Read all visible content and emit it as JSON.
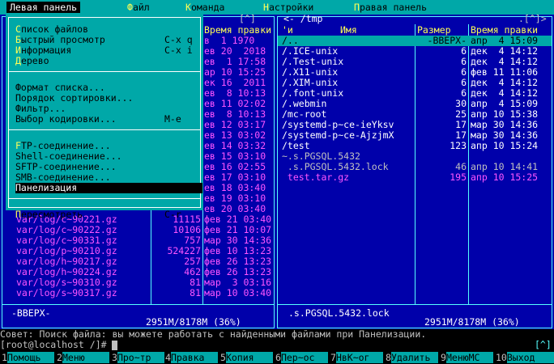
{
  "menubar": {
    "items": [
      {
        "hk": "",
        "rest": "Левая панель",
        "active": true
      },
      {
        "hk": "Ф",
        "rest": "айл"
      },
      {
        "hk": "К",
        "rest": "оманда"
      },
      {
        "hk": "Н",
        "rest": "астройки"
      },
      {
        "hk": "П",
        "rest": "равая панель"
      }
    ]
  },
  "left_panel": {
    "headers": {
      "time": "Время правки"
    },
    "top_right_marker": "[^]",
    "visible_top_rows": [
      {
        "date": "в  1 1970"
      },
      {
        "date": "ев 20  2018"
      },
      {
        "date": "ев  1 17:58"
      },
      {
        "date": "ар 10 15:25"
      },
      {
        "date": "ек 16  2011"
      },
      {
        "date": "ев  8 10:13"
      },
      {
        "date": "ев 11 02:02"
      },
      {
        "date": "ев  8 10:13"
      },
      {
        "date": "ев 12 03:17"
      },
      {
        "date": "ев 13 03:02"
      },
      {
        "date": "ев 14 03:32"
      },
      {
        "date": "ев 15 03:10"
      },
      {
        "date": "ев 16 02:55"
      },
      {
        "date": "ев 17 03:10"
      },
      {
        "date": "ев 18 03:40"
      },
      {
        "date": "ев 19 03:10"
      },
      {
        "date": "ев 20 03:40"
      }
    ],
    "files": [
      {
        "name": "var/log/c~90221.gz",
        "size": "11115",
        "date": "фев 21 03:40"
      },
      {
        "name": "var/log/c~90222.gz",
        "size": "10106",
        "date": "фев 21 10:07"
      },
      {
        "name": "var/log/c~90331.gz",
        "size": "757",
        "date": "мар 30 14:36"
      },
      {
        "name": "var/log/p~90210.gz",
        "size": "524227",
        "date": "фев 10 13:23"
      },
      {
        "name": "var/log/h~90217.gz",
        "size": "257",
        "date": "фев 26 13:23"
      },
      {
        "name": "var/log/h~90224.gz",
        "size": "462",
        "date": "фев 26 13:23"
      },
      {
        "name": "var/log/s~90310.gz",
        "size": "81",
        "date": "мар  3 03:16"
      },
      {
        "name": "var/log/s~90317.gz",
        "size": "81",
        "date": "мар 10 03:40"
      }
    ],
    "status": "-ВВЕРХ-",
    "free": "2951M/8178M (36%)"
  },
  "right_panel": {
    "path": "<- /tmp",
    "top_right_marker": ".[^]>",
    "headers": {
      "sort": "'и",
      "name": "Имя",
      "size": "Размер",
      "time": "Время правки"
    },
    "files": [
      {
        "name": "/..",
        "size": "-ВВЕРХ-",
        "date": "апр  4 15:09",
        "color": "white"
      },
      {
        "name": "/.ICE-unix",
        "size": "6",
        "date": "дек  4 14:12",
        "color": "white"
      },
      {
        "name": "/.Test-unix",
        "size": "6",
        "date": "дек  4 14:12",
        "color": "white"
      },
      {
        "name": "/.X11-unix",
        "size": "6",
        "date": "фев 11 11:06",
        "color": "white"
      },
      {
        "name": "/.XIM-unix",
        "size": "6",
        "date": "дек  4 14:12",
        "color": "white"
      },
      {
        "name": "/.font-unix",
        "size": "6",
        "date": "дек  4 14:12",
        "color": "white"
      },
      {
        "name": "/.webmin",
        "size": "30",
        "date": "апр  4 15:09",
        "color": "white"
      },
      {
        "name": "/mc-root",
        "size": "25",
        "date": "апр 10 15:38",
        "color": "white"
      },
      {
        "name": "/systemd-p~ce-ieYksv",
        "size": "17",
        "date": "мар 30 14:36",
        "color": "white"
      },
      {
        "name": "/systemd-p~ce-AjzjmX",
        "size": "17",
        "date": "мар 30 14:36",
        "color": "white"
      },
      {
        "name": "/test",
        "size": "123",
        "date": "апр 10 15:24",
        "color": "white"
      },
      {
        "name": "~.s.PGSQL.5432",
        "size": "",
        "date": "",
        "color": "gray"
      },
      {
        "name": " .s.PGSQL.5432.lock",
        "size": "46",
        "date": "апр 10 14:41",
        "color": "gray"
      },
      {
        "name": " test.tar.gz",
        "size": "195",
        "date": "апр 10 15:25",
        "color": "magenta"
      }
    ],
    "status": ".s.PGSQL.5432.lock",
    "free": "2951M/8178M (36%)"
  },
  "dropdown": {
    "groups": [
      [
        {
          "hk": "С",
          "rest": "писок файлов",
          "sc": ""
        },
        {
          "hk": "Б",
          "rest": "ыстрый просмотр",
          "sc": "C-x q"
        },
        {
          "hk": "И",
          "rest": "нформация",
          "sc": "C-x i"
        },
        {
          "hk": "Д",
          "rest": "ерево",
          "sc": ""
        }
      ],
      [
        {
          "hk": "",
          "rest": "Формат списка...",
          "hkmid": "м",
          "sc": ""
        },
        {
          "hk": "",
          "rest": "Порядок сортировки...",
          "sc": ""
        },
        {
          "hk": "",
          "rest": "Фильтр...",
          "sc": ""
        },
        {
          "hk": "",
          "rest": "Выбор кодировки...",
          "sc": "M-e"
        }
      ],
      [
        {
          "hk": "F",
          "rest": "TP-соединение...",
          "sc": ""
        },
        {
          "hk": "",
          "rest": "Shell-соединение...",
          "sc": ""
        },
        {
          "hk": "",
          "rest": "SFTP-соединение...",
          "sc": ""
        },
        {
          "hk": "",
          "rest": "SMB-соединение...",
          "sc": ""
        },
        {
          "hk": "",
          "rest": "Панелизация",
          "sc": "",
          "selected": true
        }
      ],
      [
        {
          "hk": "П",
          "rest": "ересмотреть",
          "sc": "C-r"
        }
      ]
    ]
  },
  "hint": "Совет: Поиск файла: вы можете работать с найденными файлами при Панелизации.",
  "prompt": "[root@localhost /]# ",
  "prompt_marker": "[^]",
  "fkeys": [
    {
      "n": "1",
      "label": "Помощь"
    },
    {
      "n": "2",
      "label": "Меню"
    },
    {
      "n": "3",
      "label": "Про~тр"
    },
    {
      "n": "4",
      "label": "Правка"
    },
    {
      "n": "5",
      "label": "Копия"
    },
    {
      "n": "6",
      "label": "Пер~ос"
    },
    {
      "n": "7",
      "label": "НвК~ог"
    },
    {
      "n": "8",
      "label": "Удалить"
    },
    {
      "n": "9",
      "label": "МенюМС"
    },
    {
      "n": "10",
      "label": "Выход"
    }
  ],
  "colors": {
    "bg": "#0000aa",
    "cyan": "#00a8a8",
    "border": "#55ffff",
    "highlight": "#ffff55",
    "magenta": "#ff55ff"
  }
}
